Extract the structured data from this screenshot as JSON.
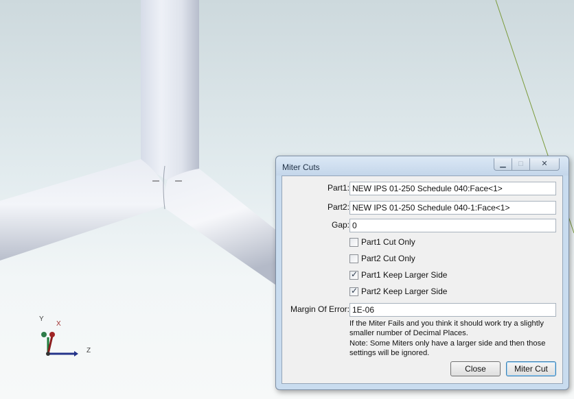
{
  "triad": {
    "y_label": "Y",
    "x_label": "X",
    "z_label": "Z"
  },
  "dialog": {
    "title": "Miter Cuts",
    "min_glyph": "▁",
    "max_glyph": "□",
    "close_glyph": "✕",
    "fields": {
      "part1": {
        "label": "Part1:",
        "value": "NEW IPS 01-250 Schedule 040:Face<1>"
      },
      "part2": {
        "label": "Part2:",
        "value": "NEW IPS 01-250 Schedule 040-1:Face<1>"
      },
      "gap": {
        "label": "Gap:",
        "value": "0"
      },
      "margin": {
        "label": "Margin Of Error:",
        "value": "1E-06"
      }
    },
    "checkboxes": [
      {
        "label": "Part1 Cut Only",
        "checked": false
      },
      {
        "label": "Part2 Cut Only",
        "checked": false
      },
      {
        "label": "Part1 Keep Larger Side",
        "checked": true
      },
      {
        "label": "Part2 Keep Larger Side",
        "checked": true
      }
    ],
    "check_glyph": "✓",
    "note1": "If the Miter Fails and you think it should work try a slightly smaller number of Decimal Places.",
    "note2": "Note: Some Miters only have a larger side and then those settings will be ignored.",
    "close_button": "Close",
    "miter_button": "Miter Cut"
  }
}
